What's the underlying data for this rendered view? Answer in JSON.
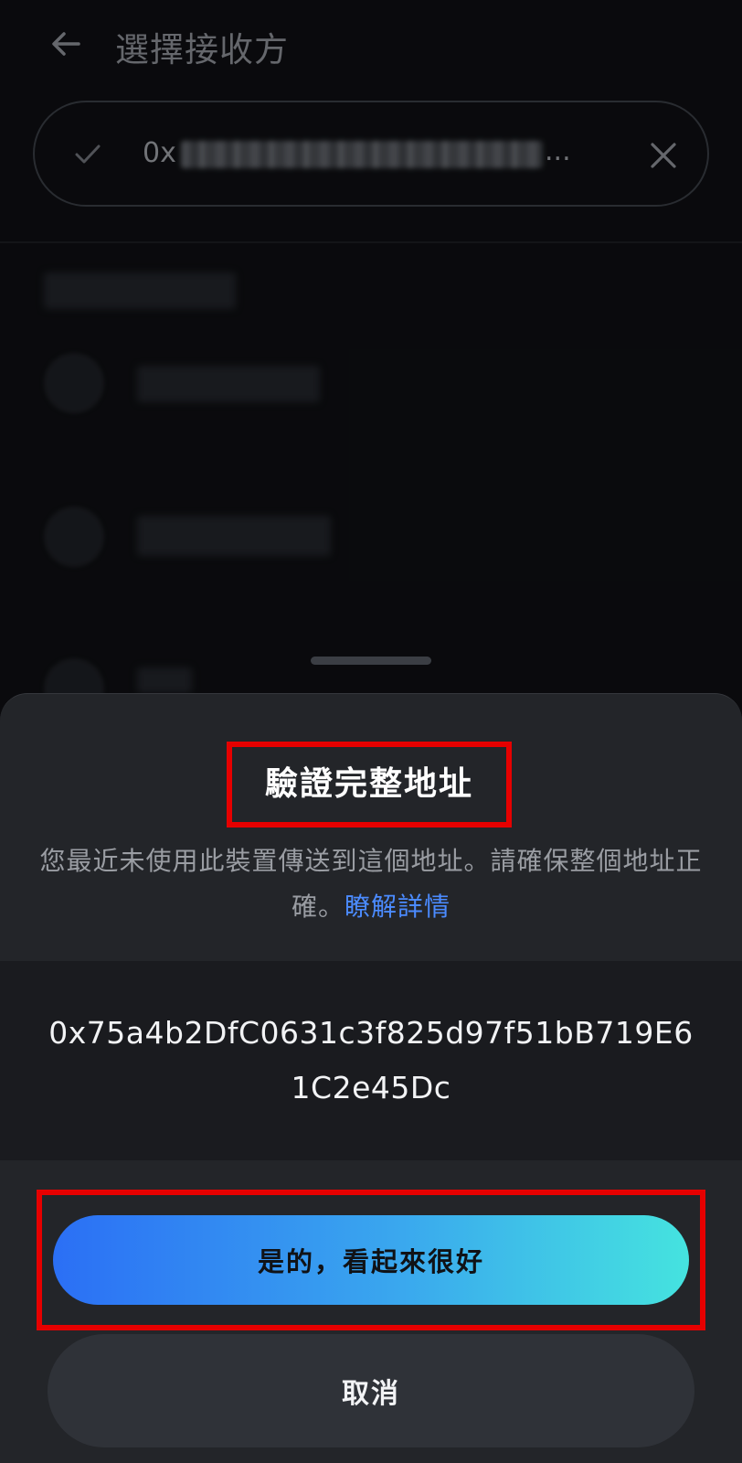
{
  "header": {
    "title": "選擇接收方"
  },
  "search": {
    "address_prefix": "0x",
    "address_ellipsis": "..."
  },
  "sheet": {
    "title": "驗證完整地址",
    "description": "您最近未使用此裝置傳送到這個地址。請確保整個地址正確。",
    "learn_more": "瞭解詳情",
    "full_address": "0x75a4b2DfC0631c3f825d97f51bB719E61C2e45Dc",
    "confirm_label": "是的，看起來很好",
    "cancel_label": "取消"
  },
  "colors": {
    "accent_gradient_start": "#2b6ff5",
    "accent_gradient_end": "#45e3df",
    "link": "#4b8bff",
    "highlight_box": "#e60000",
    "sheet_background": "#232529"
  },
  "icons": {
    "back": "arrow-left-icon",
    "check": "check-icon",
    "clear": "close-icon"
  }
}
